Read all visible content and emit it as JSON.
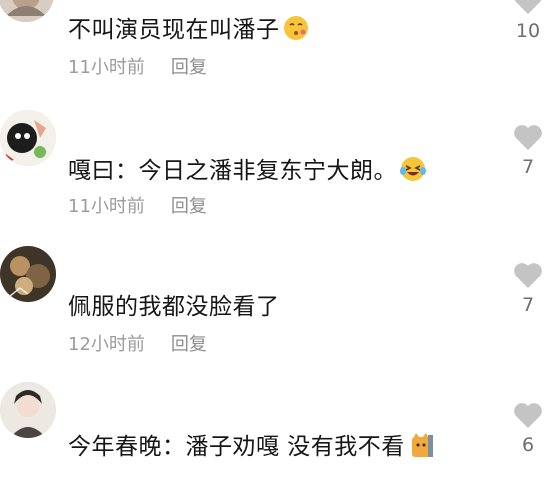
{
  "comments": [
    {
      "username": "",
      "text": "不叫演员现在叫潘子",
      "emoji": "emoji-kiss-icon",
      "time": "11小时前",
      "reply_label": "回复",
      "likes": "10"
    },
    {
      "username": "",
      "text": "嘎曰：今日之潘非复东宁大朗。",
      "emoji": "emoji-laughing-tears-icon",
      "time": "11小时前",
      "reply_label": "回复",
      "likes": "7"
    },
    {
      "username": "",
      "text": "佩服的我都没脸看了",
      "emoji": "",
      "time": "12小时前",
      "reply_label": "回复",
      "likes": "7"
    },
    {
      "username": "",
      "text": "今年春晚：潘子劝嘎 没有我不看",
      "emoji": "emoji-cat-icon",
      "time": "",
      "reply_label": "",
      "likes": "6"
    }
  ],
  "colors": {
    "heart": "#c4c4c4",
    "meta": "#9c9c9c",
    "text": "#161616"
  }
}
